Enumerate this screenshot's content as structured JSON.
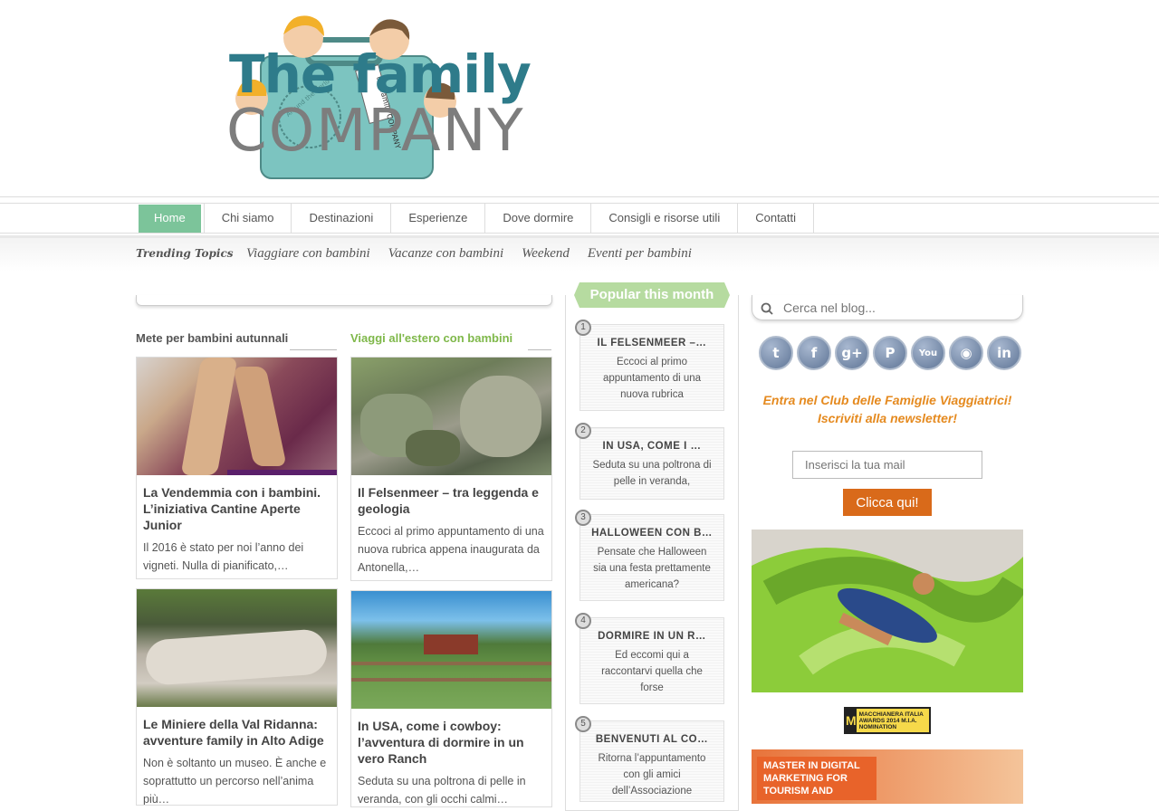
{
  "logo": {
    "line1": "The family",
    "line2": "COMPANY",
    "tag": "the family COMPANY",
    "stamp": "Around the world"
  },
  "nav": {
    "items": [
      "Home",
      "Chi siamo",
      "Destinazioni",
      "Esperienze",
      "Dove dormire",
      "Consigli e risorse utili",
      "Contatti"
    ],
    "active": "Home"
  },
  "trending": {
    "label": "Trending Topics",
    "items": [
      "Viaggiare con bambini",
      "Vacanze con bambini",
      "Weekend",
      "Eventi per bambini"
    ]
  },
  "columns": {
    "left_title": "Mete per bambini autunnali",
    "right_title": "Viaggi all'estero con bambini",
    "colors": {
      "left": "#555555",
      "right": "#7fb84a"
    }
  },
  "cards": [
    {
      "title": "La Vendemmia con i bambini. L’iniziativa Cantine Aperte Junior",
      "excerpt": "Il 2016 è stato per noi l’anno dei vigneti. Nulla di pianificato,…"
    },
    {
      "title": "Il Felsenmeer – tra leggenda e geologia",
      "excerpt": "Eccoci al primo appuntamento di una nuova rubrica appena inaugurata da Antonella,…"
    },
    {
      "title": "Le Miniere della Val Ridanna: avventure family in Alto Adige",
      "excerpt": "Non è soltanto un museo. È anche e soprattutto un percorso nell’anima più…"
    },
    {
      "title": "In USA, come i cowboy: l’avventura di dormire in un vero Ranch",
      "excerpt": "Seduta su una poltrona di pelle in veranda, con gli occhi calmi…"
    }
  ],
  "popular": {
    "title": "Popular this month",
    "items": [
      {
        "num": "1",
        "title": "IL FELSENMEER –…",
        "excerpt": "Eccoci al primo appuntamento di una nuova rubrica"
      },
      {
        "num": "2",
        "title": "IN USA, COME I …",
        "excerpt": "Seduta su una poltrona di pelle in veranda,"
      },
      {
        "num": "3",
        "title": "HALLOWEEN CON B…",
        "excerpt": "Pensate che Halloween sia una festa prettamente americana?"
      },
      {
        "num": "4",
        "title": "DORMIRE IN UN R…",
        "excerpt": "Ed eccomi qui a raccontarvi quella che forse"
      },
      {
        "num": "5",
        "title": "BENVENUTI AL CO…",
        "excerpt": "Ritorna l’appuntamento con gli amici dell’Associazione"
      }
    ]
  },
  "search": {
    "placeholder": "Cerca nel blog..."
  },
  "social": [
    {
      "name": "twitter-icon",
      "glyph": "t"
    },
    {
      "name": "facebook-icon",
      "glyph": "f"
    },
    {
      "name": "google-plus-icon",
      "glyph": "g+"
    },
    {
      "name": "pinterest-icon",
      "glyph": "P"
    },
    {
      "name": "youtube-icon",
      "glyph": "You"
    },
    {
      "name": "rss-icon",
      "glyph": "◉"
    },
    {
      "name": "linkedin-icon",
      "glyph": "in"
    }
  ],
  "newsletter": {
    "line1": "Entra nel Club delle Famiglie Viaggiatrici!",
    "line2": "Iscriviti alla newsletter!",
    "placeholder": "Inserisci la tua mail",
    "button": "Clicca qui!"
  },
  "badge": {
    "letter": "M",
    "text": "MACCHIANERA ITALIA AWARDS 2014 M.I.A. NOMINATION"
  },
  "master": {
    "text": "MASTER IN DIGITAL MARKETING FOR TOURISM AND"
  }
}
